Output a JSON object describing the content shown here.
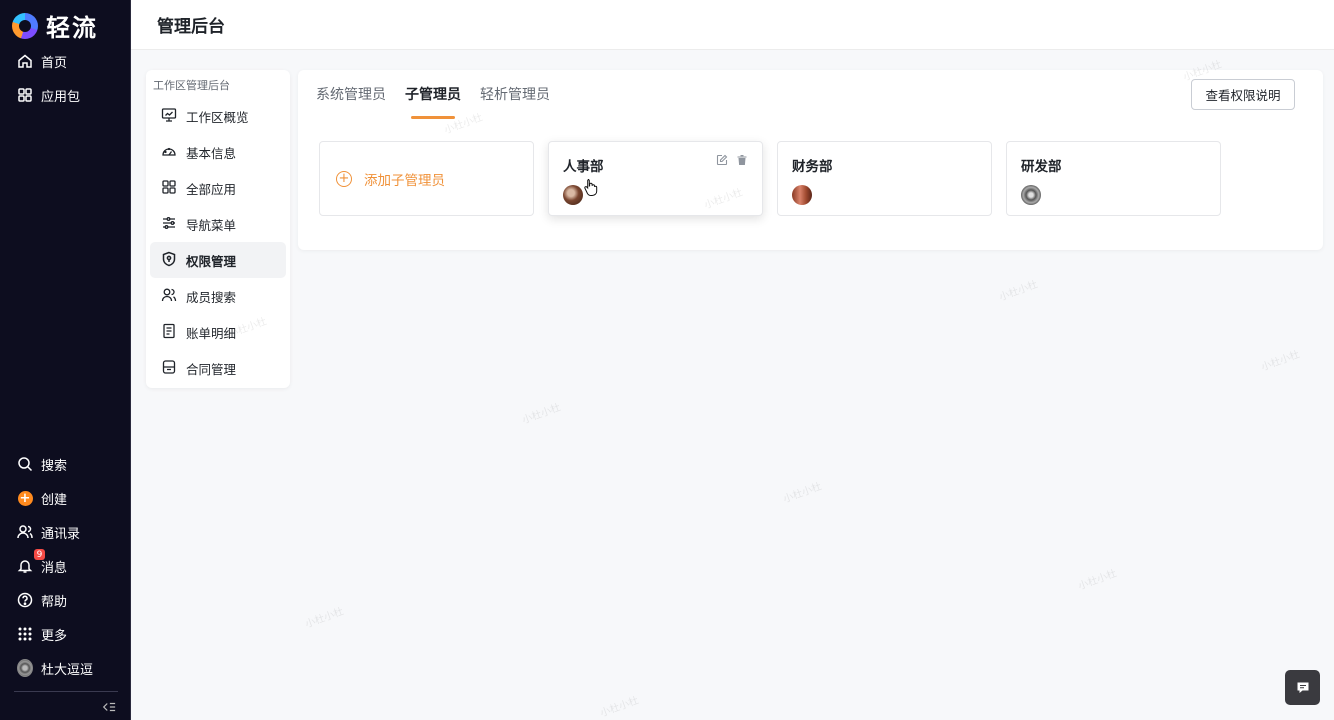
{
  "app": {
    "logo_text": "轻流"
  },
  "sidebar": {
    "top_items": [
      {
        "label": "首页",
        "icon": "home-icon"
      },
      {
        "label": "应用包",
        "icon": "grid-icon"
      }
    ],
    "bottom_items": [
      {
        "label": "搜索",
        "icon": "search-icon"
      },
      {
        "label": "创建",
        "icon": "plus-icon"
      },
      {
        "label": "通讯录",
        "icon": "contacts-icon"
      },
      {
        "label": "消息",
        "icon": "bell-icon",
        "badge": "9"
      },
      {
        "label": "帮助",
        "icon": "help-icon"
      },
      {
        "label": "更多",
        "icon": "dots-grid-icon"
      },
      {
        "label": "杜大逗逗",
        "icon": "avatar"
      }
    ]
  },
  "header": {
    "title": "管理后台"
  },
  "menu": {
    "heading": "工作区管理后台",
    "items": [
      {
        "label": "工作区概览",
        "icon": "monitor-icon"
      },
      {
        "label": "基本信息",
        "icon": "dashboard-icon"
      },
      {
        "label": "全部应用",
        "icon": "apps-icon"
      },
      {
        "label": "导航菜单",
        "icon": "sliders-icon"
      },
      {
        "label": "权限管理",
        "icon": "shield-icon",
        "active": true
      },
      {
        "label": "成员搜索",
        "icon": "users-icon"
      },
      {
        "label": "账单明细",
        "icon": "bill-icon"
      },
      {
        "label": "合同管理",
        "icon": "contract-icon"
      }
    ]
  },
  "tabs": [
    {
      "label": "系统管理员"
    },
    {
      "label": "子管理员",
      "active": true
    },
    {
      "label": "轻析管理员"
    }
  ],
  "perm_button": "查看权限说明",
  "add_card": {
    "label": "添加子管理员"
  },
  "departments": [
    {
      "name": "人事部",
      "avatar": "av-1",
      "hover": true
    },
    {
      "name": "财务部",
      "avatar": "av-2"
    },
    {
      "name": "研发部",
      "avatar": "av-3"
    }
  ],
  "watermark": "小杜小杜",
  "colors": {
    "accent": "#f0923a",
    "sidebar_bg": "#0d0d1f",
    "badge": "#f54a45"
  }
}
